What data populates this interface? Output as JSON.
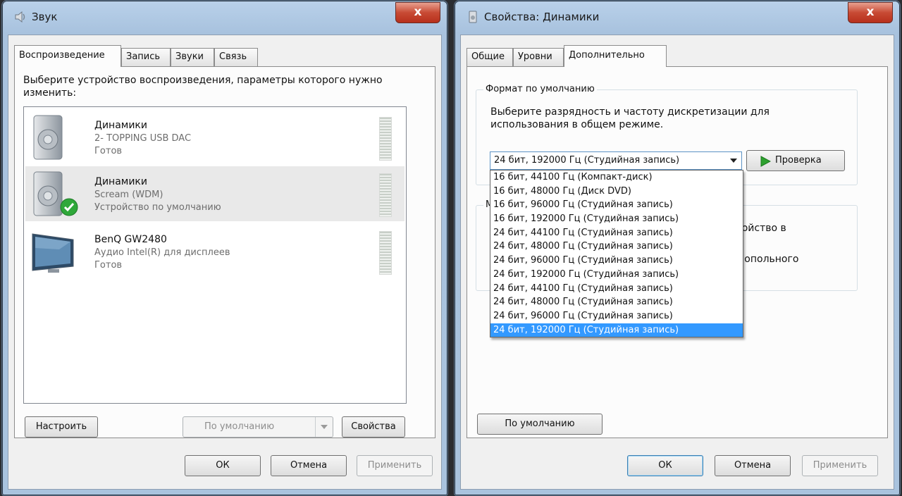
{
  "left_window": {
    "title": "Звук",
    "close_label": "x",
    "tabs": [
      {
        "label": "Воспроизведение",
        "active": true
      },
      {
        "label": "Запись",
        "active": false
      },
      {
        "label": "Звуки",
        "active": false
      },
      {
        "label": "Связь",
        "active": false
      }
    ],
    "instruction": "Выберите устройство воспроизведения, параметры которого нужно изменить:",
    "devices": [
      {
        "name": "Динамики",
        "sub": "2- TOPPING USB DAC",
        "status": "Готов",
        "icon": "speaker-icon"
      },
      {
        "name": "Динамики",
        "sub": "Scream (WDM)",
        "status": "Устройство по умолчанию",
        "icon": "speaker-icon",
        "default": true
      },
      {
        "name": "BenQ GW2480",
        "sub": "Аудио Intel(R) для дисплеев",
        "status": "Готов",
        "icon": "monitor-icon"
      }
    ],
    "buttons": {
      "configure": "Настроить",
      "set_default": "По умолчанию",
      "properties": "Свойства",
      "ok": "ОК",
      "cancel": "Отмена",
      "apply": "Применить"
    }
  },
  "right_window": {
    "title": "Свойства: Динамики",
    "close_label": "x",
    "tabs": [
      {
        "label": "Общие",
        "active": false
      },
      {
        "label": "Уровни",
        "active": false
      },
      {
        "label": "Дополнительно",
        "active": true
      }
    ],
    "default_format": {
      "group_title": "Формат по умолчанию",
      "description": "Выберите разрядность и частоту дискретизации для использования в общем режиме.",
      "selected": "24 бит, 192000 Гц (Студийная запись)",
      "test_label": "Проверка",
      "options": [
        "16 бит, 44100 Гц (Компакт-диск)",
        "16 бит, 48000 Гц (Диск DVD)",
        "16 бит, 96000 Гц (Студийная запись)",
        "16 бит, 192000 Гц (Студийная запись)",
        "24 бит, 44100 Гц (Студийная запись)",
        "24 бит, 48000 Гц (Студийная запись)",
        "24 бит, 96000 Гц (Студийная запись)",
        "24 бит, 192000 Гц (Студийная запись)",
        "24 бит, 44100 Гц (Студийная запись)",
        "24 бит, 48000 Гц (Студийная запись)",
        "24 бит, 96000 Гц (Студийная запись)",
        "24 бит, 192000 Гц (Студийная запись)"
      ],
      "highlighted_index": 11
    },
    "exclusive_mode": {
      "group_title_fragment": "М",
      "text_fragment_1": "стройство в",
      "text_fragment_2": "монопольного"
    },
    "buttons": {
      "restore_default": "По умолчанию",
      "ok": "ОК",
      "cancel": "Отмена",
      "apply": "Применить"
    }
  },
  "colors": {
    "selection": "#3399ff",
    "check_green": "#2fa83a",
    "play_green": "#2da12f"
  }
}
